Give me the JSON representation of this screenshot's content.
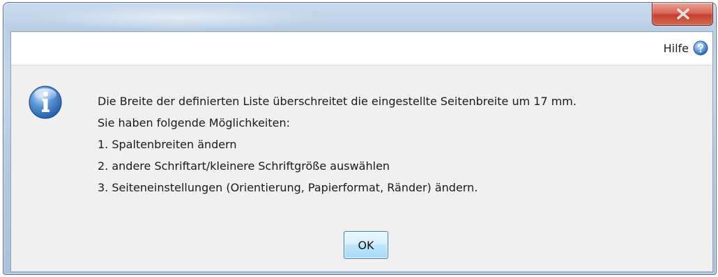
{
  "window": {
    "close_glyph": "x"
  },
  "help": {
    "label": "Hilfe",
    "icon": "help-question-icon"
  },
  "message": {
    "icon": "info-icon",
    "lines": [
      "Die Breite der definierten Liste überschreitet die eingestellte Seitenbreite um 17 mm.",
      "Sie haben folgende Möglichkeiten:",
      "1. Spaltenbreiten ändern",
      "2. andere Schriftart/kleinere Schriftgröße auswählen",
      "3. Seiteneinstellungen (Orientierung, Papierformat, Ränder) ändern."
    ]
  },
  "buttons": {
    "ok_label": "OK"
  },
  "colors": {
    "accent": "#3c7fb1",
    "close_button": "#c5402f",
    "info_icon": "#2f6fba"
  }
}
